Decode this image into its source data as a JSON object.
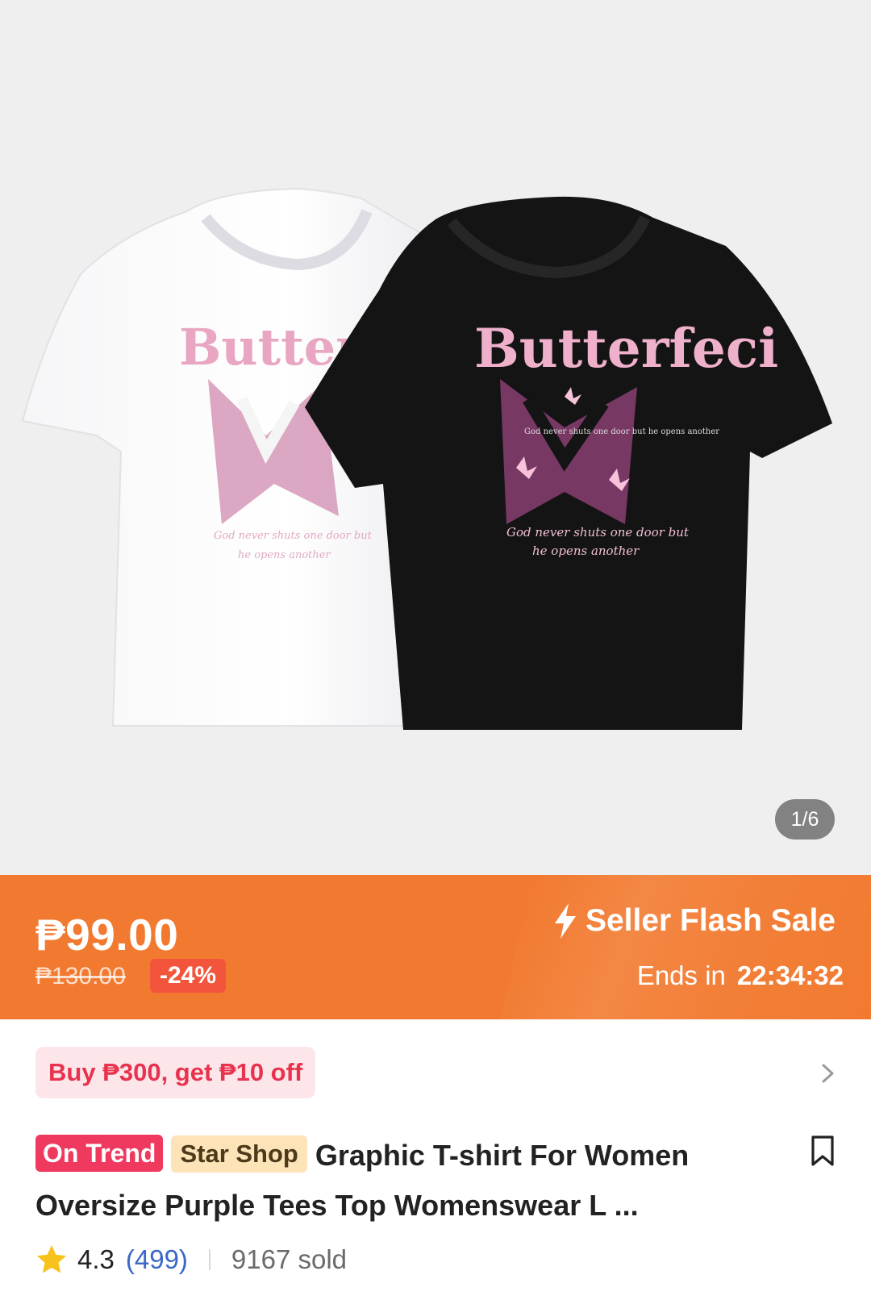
{
  "gallery": {
    "counter": "1/6",
    "shirt_print_title": "Butterfeci",
    "shirt_print_small": "God never shuts one door but he opens another",
    "shirt_print_script_1": "God never shuts one door but",
    "shirt_print_script_2": "he opens another"
  },
  "banner": {
    "price": "₱99.00",
    "old_price": "₱130.00",
    "discount": "-24%",
    "flash_label": "Seller Flash Sale",
    "ends_label": "Ends in",
    "countdown": "22:34:32",
    "color": "#f27a30"
  },
  "voucher": {
    "label": "Buy ₱300, get ₱10 off"
  },
  "product": {
    "tag_trend": "On Trend",
    "tag_shop": "Star Shop",
    "title": "Graphic T-shirt For Women Oversize Purple Tees Top Womenswear L ..."
  },
  "rating": {
    "value": "4.3",
    "count": "(499)",
    "sold": "9167 sold"
  },
  "icons": [
    "lightning-icon",
    "chevron-right-icon",
    "bookmark-icon",
    "star-icon"
  ]
}
